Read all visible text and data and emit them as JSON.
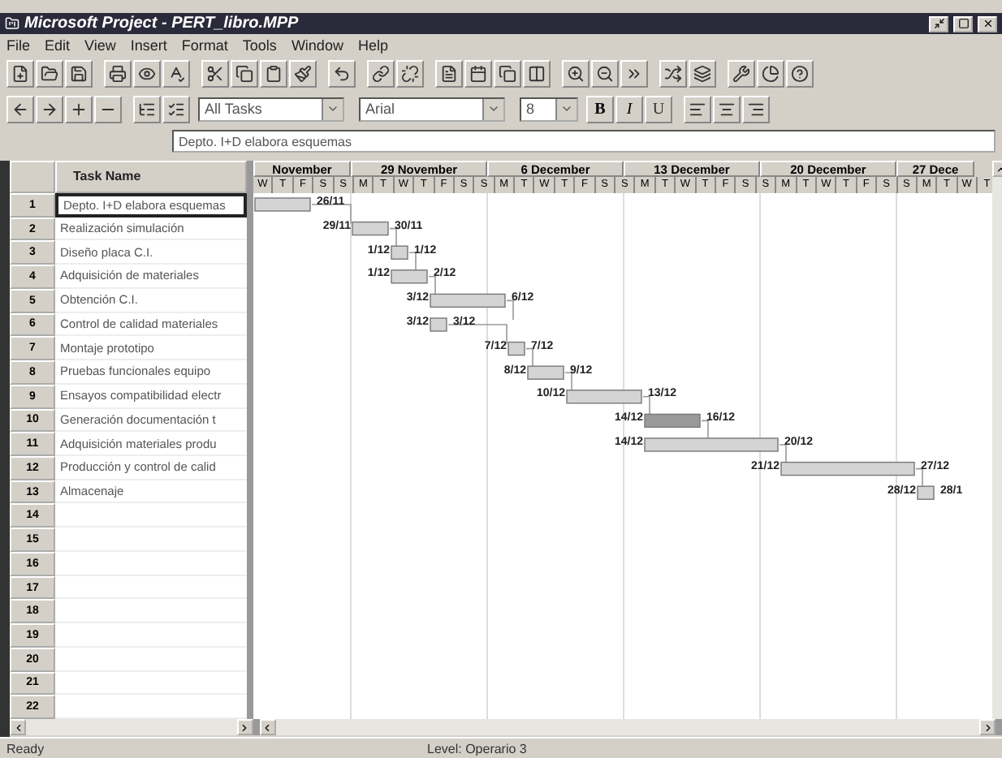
{
  "window": {
    "title": "Microsoft Project - PERT_libro.MPP"
  },
  "menu": [
    "File",
    "Edit",
    "View",
    "Insert",
    "Format",
    "Tools",
    "Window",
    "Help"
  ],
  "formatting": {
    "filter": "All Tasks",
    "font": "Arial",
    "size": "8",
    "bold": "B",
    "italic": "I",
    "underline": "U"
  },
  "entry_bar": {
    "value": "Depto. I+D elabora esquemas"
  },
  "table": {
    "columns": [
      "Task Name"
    ],
    "rows": [
      {
        "id": "1",
        "name": "Depto. I+D elabora esquemas",
        "selected": true
      },
      {
        "id": "2",
        "name": "Realización simulación",
        "selected": false
      },
      {
        "id": "3",
        "name": "Diseño placa C.I.",
        "selected": false
      },
      {
        "id": "4",
        "name": "Adquisición de materiales",
        "selected": false
      },
      {
        "id": "5",
        "name": "Obtención C.I.",
        "selected": false
      },
      {
        "id": "6",
        "name": "Control de calidad materiales",
        "selected": false
      },
      {
        "id": "7",
        "name": "Montaje prototipo",
        "selected": false
      },
      {
        "id": "8",
        "name": "Pruebas funcionales equipo",
        "selected": false
      },
      {
        "id": "9",
        "name": "Ensayos compatibilidad electr",
        "selected": false
      },
      {
        "id": "10",
        "name": "Generación documentación t",
        "selected": false
      },
      {
        "id": "11",
        "name": "Adquisición materiales produ",
        "selected": false
      },
      {
        "id": "12",
        "name": "Producción y control de calid",
        "selected": false
      },
      {
        "id": "13",
        "name": "Almacenaje",
        "selected": false
      },
      {
        "id": "14"
      },
      {
        "id": "15"
      },
      {
        "id": "16"
      },
      {
        "id": "17"
      },
      {
        "id": "18"
      },
      {
        "id": "19"
      },
      {
        "id": "20"
      },
      {
        "id": "21"
      },
      {
        "id": "22"
      }
    ]
  },
  "gantt": {
    "weeks": [
      {
        "label": "November",
        "days": [
          "W",
          "T",
          "F",
          "S",
          "S"
        ]
      },
      {
        "label": "29 November",
        "days": [
          "M",
          "T",
          "W",
          "T",
          "F",
          "S",
          "S"
        ]
      },
      {
        "label": "6 December",
        "days": [
          "M",
          "T",
          "W",
          "T",
          "F",
          "S",
          "S"
        ]
      },
      {
        "label": "13 December",
        "days": [
          "M",
          "T",
          "W",
          "T",
          "F",
          "S",
          "S"
        ]
      },
      {
        "label": "20 December",
        "days": [
          "M",
          "T",
          "W",
          "T",
          "F",
          "S",
          "S"
        ]
      },
      {
        "label": "27 Dece",
        "days": [
          "M",
          "T",
          "W",
          "T"
        ]
      }
    ],
    "bars": [
      {
        "finish": "26/11",
        "critical": false
      },
      {
        "start": "29/11",
        "finish": "30/11",
        "critical": false
      },
      {
        "start": "1/12",
        "finish": "1/12",
        "critical": false
      },
      {
        "start": "1/12",
        "finish": "2/12",
        "critical": false
      },
      {
        "start": "3/12",
        "finish": "6/12",
        "critical": false
      },
      {
        "start": "3/12",
        "finish": "3/12",
        "critical": false
      },
      {
        "start": "7/12",
        "finish": "7/12",
        "critical": false
      },
      {
        "start": "8/12",
        "finish": "9/12",
        "critical": false
      },
      {
        "start": "10/12",
        "finish": "13/12",
        "critical": false
      },
      {
        "start": "14/12",
        "finish": "16/12",
        "critical": true
      },
      {
        "start": "14/12",
        "finish": "20/12",
        "critical": false
      },
      {
        "start": "21/12",
        "finish": "27/12",
        "critical": false
      },
      {
        "start": "28/12",
        "finish": "28/1",
        "critical": false
      }
    ]
  },
  "status_bar": {
    "state": "Ready",
    "level": "Level: Operario 3"
  }
}
